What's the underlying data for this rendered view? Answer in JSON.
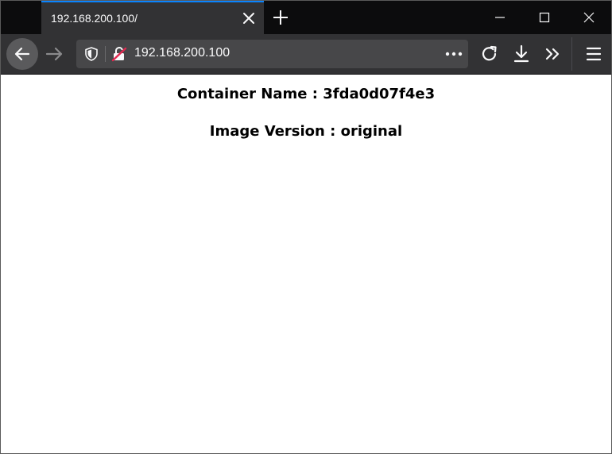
{
  "tab": {
    "title": "192.168.200.100/"
  },
  "toolbar": {
    "url": "192.168.200.100"
  },
  "icons": {
    "close_tab": "close-icon",
    "new_tab": "plus-icon",
    "back": "arrow-left-icon",
    "forward": "arrow-right-icon",
    "tracking": "shield-icon",
    "insecure": "broken-lock-icon",
    "page_actions": "more-horizontal-icon",
    "reload": "reload-icon",
    "download": "download-icon",
    "overflow": "chevron-double-right-icon",
    "menu": "hamburger-menu-icon"
  },
  "colors": {
    "tab_accent": "#0a84ff",
    "toolbar_bg": "#323234",
    "tabstrip_bg": "#0c0c0d",
    "insecure_lock": "#e22850"
  },
  "content": {
    "container_line": "Container Name : 3fda0d07f4e3",
    "version_line": "Image Version : original"
  }
}
